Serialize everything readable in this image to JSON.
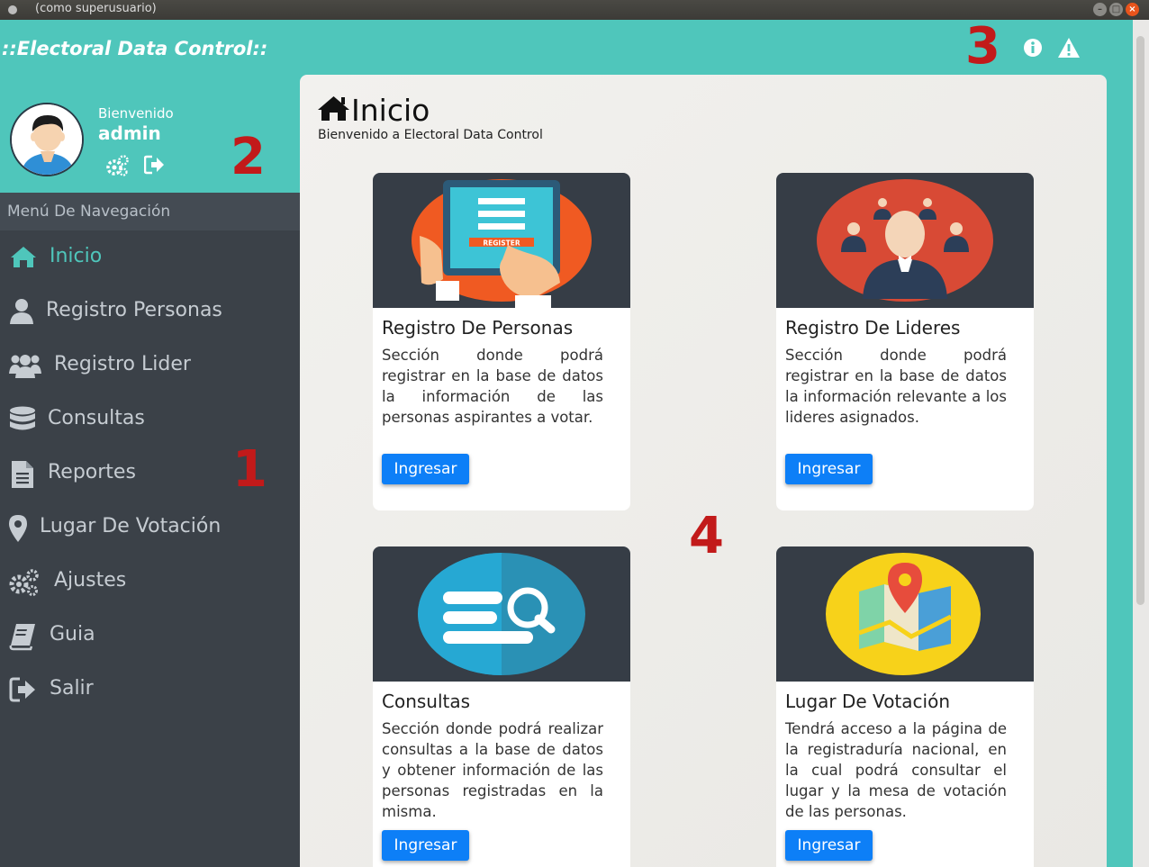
{
  "window": {
    "title": "(como superusuario)"
  },
  "app": {
    "title": "::Electoral Data Control::"
  },
  "annotations": {
    "n1": "1",
    "n2": "2",
    "n3": "3",
    "n4": "4"
  },
  "profile": {
    "welcome": "Bienvenido",
    "username": "admin"
  },
  "nav": {
    "header": "Menú De Navegación",
    "items": [
      {
        "label": "Inicio",
        "icon": "home-icon",
        "active": true
      },
      {
        "label": "Registro Personas",
        "icon": "user-icon"
      },
      {
        "label": "Registro Lider",
        "icon": "users-icon"
      },
      {
        "label": "Consultas",
        "icon": "database-icon"
      },
      {
        "label": "Reportes",
        "icon": "file-icon"
      },
      {
        "label": "Lugar De Votación",
        "icon": "map-marker-icon"
      },
      {
        "label": "Ajustes",
        "icon": "gears-icon"
      },
      {
        "label": "Guia",
        "icon": "book-icon"
      },
      {
        "label": "Salir",
        "icon": "logout-icon"
      }
    ]
  },
  "main": {
    "title": "Inicio",
    "subtitle": "Bienvenido a Electoral Data Control",
    "cards": [
      {
        "title": "Registro De Personas",
        "desc": "Sección donde podrá registrar en la base de datos la información de las personas aspirantes a votar.",
        "button": "Ingresar",
        "image_text": "REGISTER"
      },
      {
        "title": "Registro De Lideres",
        "desc": "Sección donde podrá registrar en la base de datos la información relevante a los lideres asignados.",
        "button": "Ingresar"
      },
      {
        "title": "Consultas",
        "desc": "Sección donde podrá realizar consultas a la base de datos y obtener información de las personas registradas en la misma.",
        "button": "Ingresar"
      },
      {
        "title": "Lugar De Votación",
        "desc": "Tendrá acceso a la página de la registraduría nacional, en la cual podrá consultar el lugar y la mesa de votación de las personas.",
        "button": "Ingresar"
      }
    ]
  },
  "colors": {
    "accent": "#4fc6bb",
    "sidebar": "#3b4148",
    "active": "#4fc6bb",
    "button": "#0d7ff7",
    "annotation": "#c21a1a"
  }
}
